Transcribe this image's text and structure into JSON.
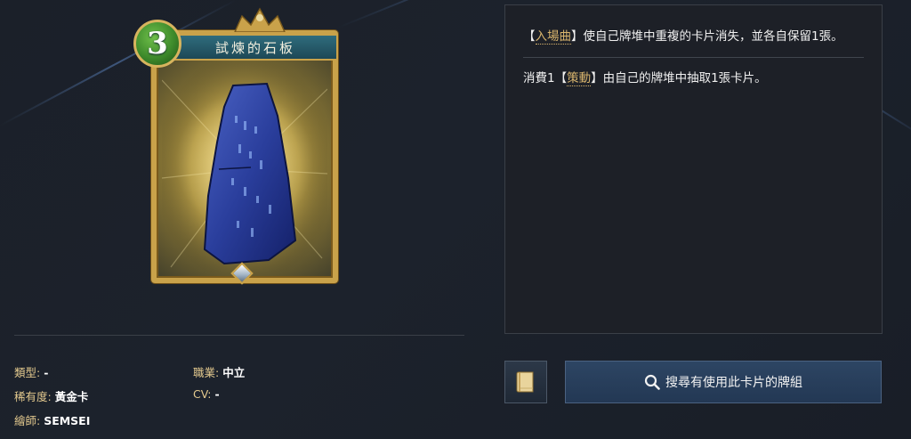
{
  "card": {
    "cost": "3",
    "name": "試煉的石板"
  },
  "description": {
    "ability1": {
      "prefix": "【",
      "keyword": "入場曲",
      "suffix": "】使自己牌堆中重複的卡片消失，並各自保留1張。"
    },
    "ability2": {
      "prefix": "消費1【",
      "keyword": "策動",
      "suffix": "】由自己的牌堆中抽取1張卡片。"
    }
  },
  "info": {
    "type_label": "類型:",
    "type_value": "-",
    "class_label": "職業:",
    "class_value": "中立",
    "rarity_label": "稀有度:",
    "rarity_value": "黃金卡",
    "cv_label": "CV:",
    "cv_value": "-",
    "artist_label": "繪師:",
    "artist_value": "SEMSEI"
  },
  "buttons": {
    "search_label": "搜尋有使用此卡片的牌組",
    "book_icon": "book-icon",
    "search_icon": "search-icon"
  },
  "colors": {
    "keyword": "#d9b56d",
    "label": "#e3c98e",
    "button_bg": "#2d4563",
    "cost_green": "#3d8a2b",
    "frame_gold": "#c9a24a"
  }
}
